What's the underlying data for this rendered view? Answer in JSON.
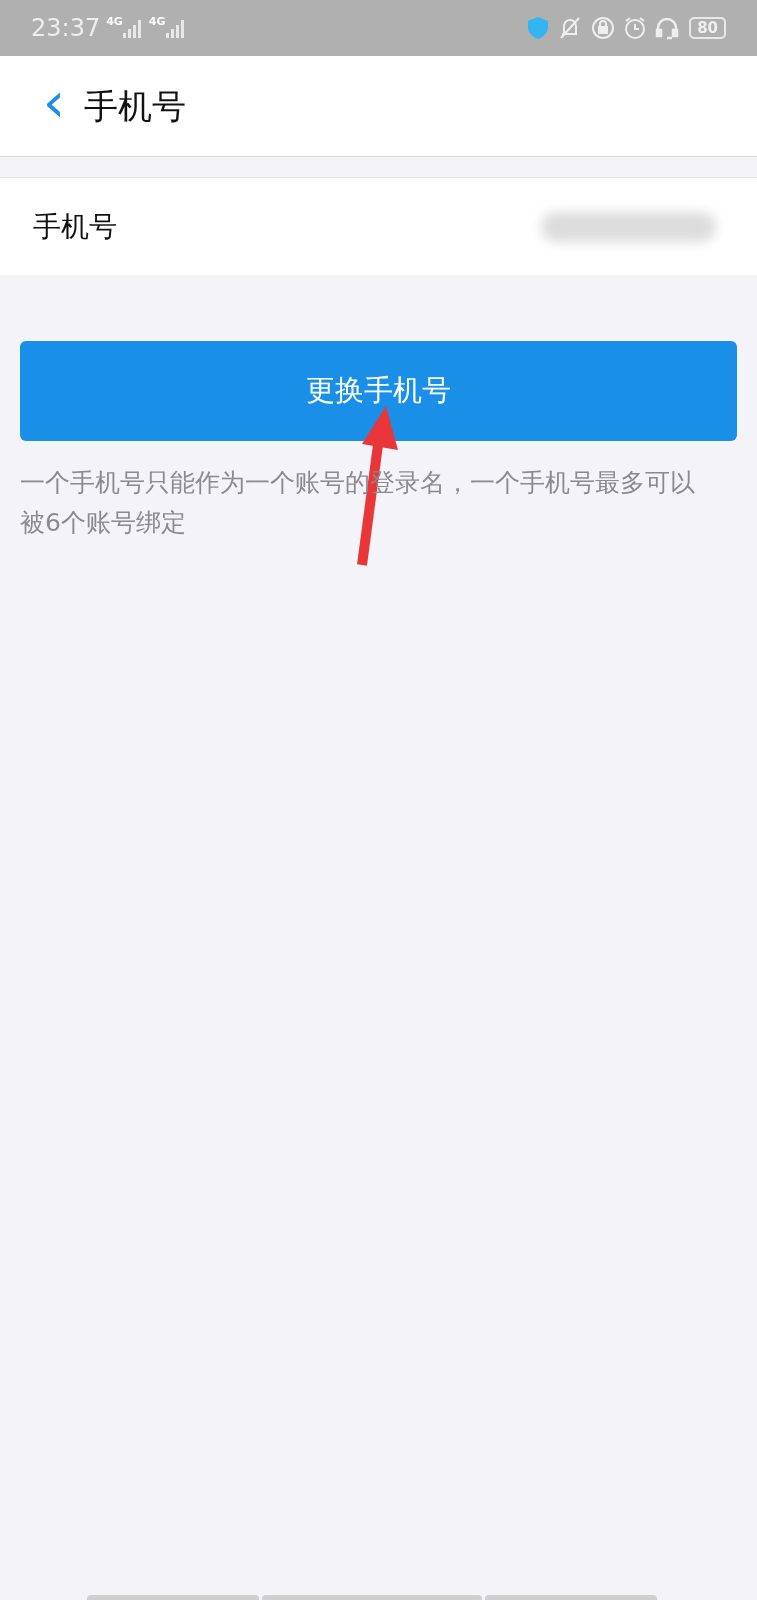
{
  "status_bar": {
    "time": "23:37",
    "network_1": "4G",
    "network_2": "4G",
    "battery": "80"
  },
  "header": {
    "back": "‹",
    "title": "手机号"
  },
  "phone_row": {
    "label": "手机号"
  },
  "change_button": {
    "label": "更换手机号"
  },
  "hint": "一个手机号只能作为一个账号的登录名，一个手机号最多可以被6个账号绑定"
}
